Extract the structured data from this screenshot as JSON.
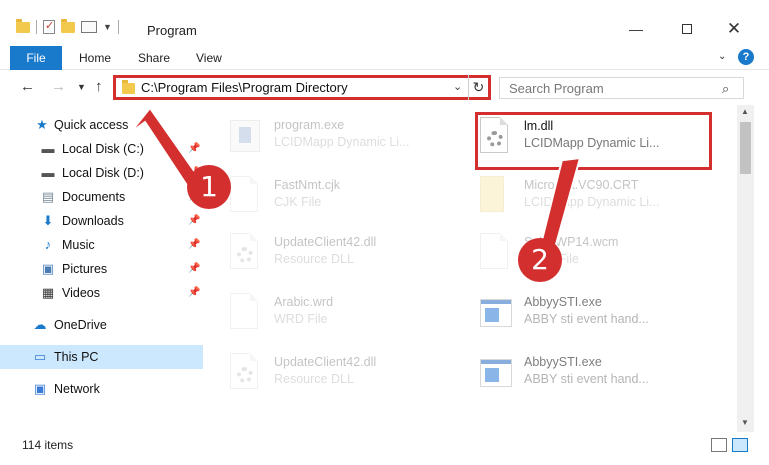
{
  "window": {
    "title": "Program",
    "minimize": "—",
    "close": "✕"
  },
  "ribbon": {
    "file": "File",
    "home": "Home",
    "share": "Share",
    "view": "View",
    "help": "?"
  },
  "nav": {
    "address": "C:\\Program Files\\Program Directory",
    "search_placeholder": "Search Program"
  },
  "sidebar": {
    "items": [
      {
        "label": "Quick access",
        "icon": "star-icon",
        "pinned": false
      },
      {
        "label": "Local Disk (C:)",
        "icon": "drive-icon",
        "pinned": true
      },
      {
        "label": "Local Disk (D:)",
        "icon": "drive-icon",
        "pinned": true
      },
      {
        "label": "Documents",
        "icon": "documents-icon",
        "pinned": true
      },
      {
        "label": "Downloads",
        "icon": "download-icon",
        "pinned": true
      },
      {
        "label": "Music",
        "icon": "music-icon",
        "pinned": true
      },
      {
        "label": "Pictures",
        "icon": "pictures-icon",
        "pinned": true
      },
      {
        "label": "Videos",
        "icon": "videos-icon",
        "pinned": true
      },
      {
        "label": "OneDrive",
        "icon": "cloud-icon",
        "pinned": false
      },
      {
        "label": "This PC",
        "icon": "computer-icon",
        "pinned": false,
        "selected": true
      },
      {
        "label": "Network",
        "icon": "network-icon",
        "pinned": false
      }
    ]
  },
  "files": [
    {
      "name": "program.exe",
      "type": "LCIDMapp Dynamic Li...",
      "faded": true
    },
    {
      "name": "lm.dll",
      "type": "LCIDMapp Dynamic Li...",
      "faded": false,
      "highlighted": true
    },
    {
      "name": "FastNmt.cjk",
      "type": "CJK File",
      "faded": true
    },
    {
      "name": "Microsoft.VC90.CRT",
      "type": "LCIDMapp Dynamic Li...",
      "faded": true
    },
    {
      "name": "UpdateClient42.dll",
      "type": "Resource DLL",
      "faded": true
    },
    {
      "name": "SalesWP14.wcm",
      "type": "WCM File",
      "faded": true
    },
    {
      "name": "Arabic.wrd",
      "type": "WRD File",
      "faded": true
    },
    {
      "name": "AbbyySTI.exe",
      "type": "ABBY sti event hand...",
      "faded": true
    },
    {
      "name": "UpdateClient42.dll",
      "type": "Resource DLL",
      "faded": true
    },
    {
      "name": "AbbyySTI.exe",
      "type": "ABBY sti event hand...",
      "faded": true
    }
  ],
  "status": {
    "item_count": "114 items"
  },
  "annotations": {
    "badge1": "1",
    "badge2": "2"
  },
  "colors": {
    "accent": "#1979ca",
    "highlight_red": "#d32f2f",
    "selected_bg": "#cce8ff"
  }
}
